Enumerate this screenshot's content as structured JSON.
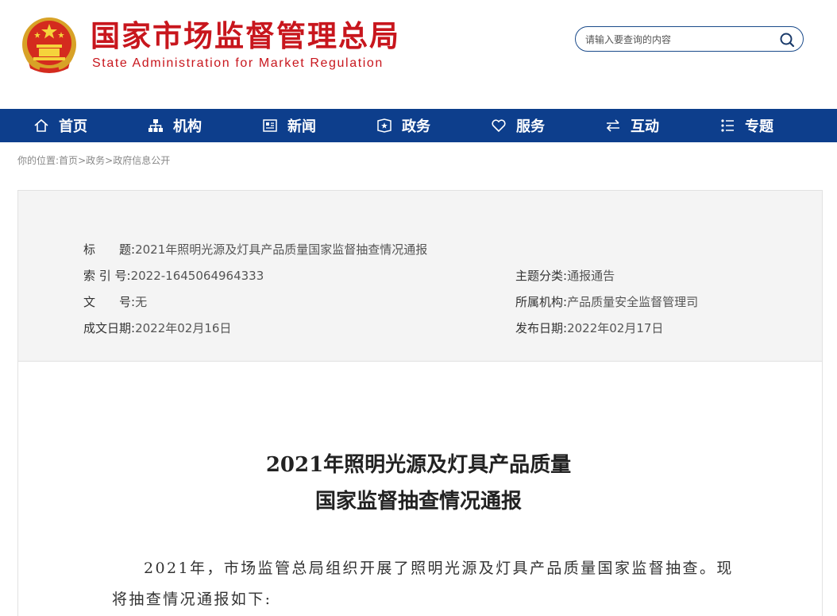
{
  "header": {
    "title_cn": "国家市场监督管理总局",
    "title_en": "State Administration for Market Regulation",
    "emblem_icon": "national-emblem-icon",
    "brand_color": "#c8161d",
    "search": {
      "placeholder": "请输入要查询的内容",
      "icon": "search-icon"
    }
  },
  "nav": {
    "bg_color": "#0d3e8c",
    "items": [
      {
        "label": "首页",
        "icon": "home-icon"
      },
      {
        "label": "机构",
        "icon": "org-chart-icon"
      },
      {
        "label": "新闻",
        "icon": "newspaper-icon"
      },
      {
        "label": "政务",
        "icon": "government-icon"
      },
      {
        "label": "服务",
        "icon": "heart-icon"
      },
      {
        "label": "互动",
        "icon": "exchange-arrows-icon"
      },
      {
        "label": "专题",
        "icon": "topic-list-icon"
      }
    ]
  },
  "breadcrumb": {
    "prefix": "你的位置:",
    "items": [
      "首页",
      "政务",
      "政府信息公开"
    ],
    "sep": ">"
  },
  "meta": {
    "title": {
      "label": "标　　题:",
      "value": "2021年照明光源及灯具产品质量国家监督抽查情况通报"
    },
    "index": {
      "label": "索 引 号:",
      "value": "2022-1645064964333"
    },
    "category": {
      "label": "主题分类:",
      "value": "通报通告"
    },
    "doc_no": {
      "label": "文　　号:",
      "value": "无"
    },
    "agency": {
      "label": "所属机构:",
      "value": "产品质量安全监督管理司"
    },
    "created": {
      "label": "成文日期:",
      "value": "2022年02月16日"
    },
    "published": {
      "label": "发布日期:",
      "value": "2022年02月17日"
    }
  },
  "article": {
    "title_line1": "2021年照明光源及灯具产品质量",
    "title_line2": "国家监督抽查情况通报",
    "para1_line1": "2021年，市场监管总局组织开展了照明光源及灯具产品质量国家监督抽查。现",
    "para1_line2": "将抽查情况通报如下:"
  }
}
